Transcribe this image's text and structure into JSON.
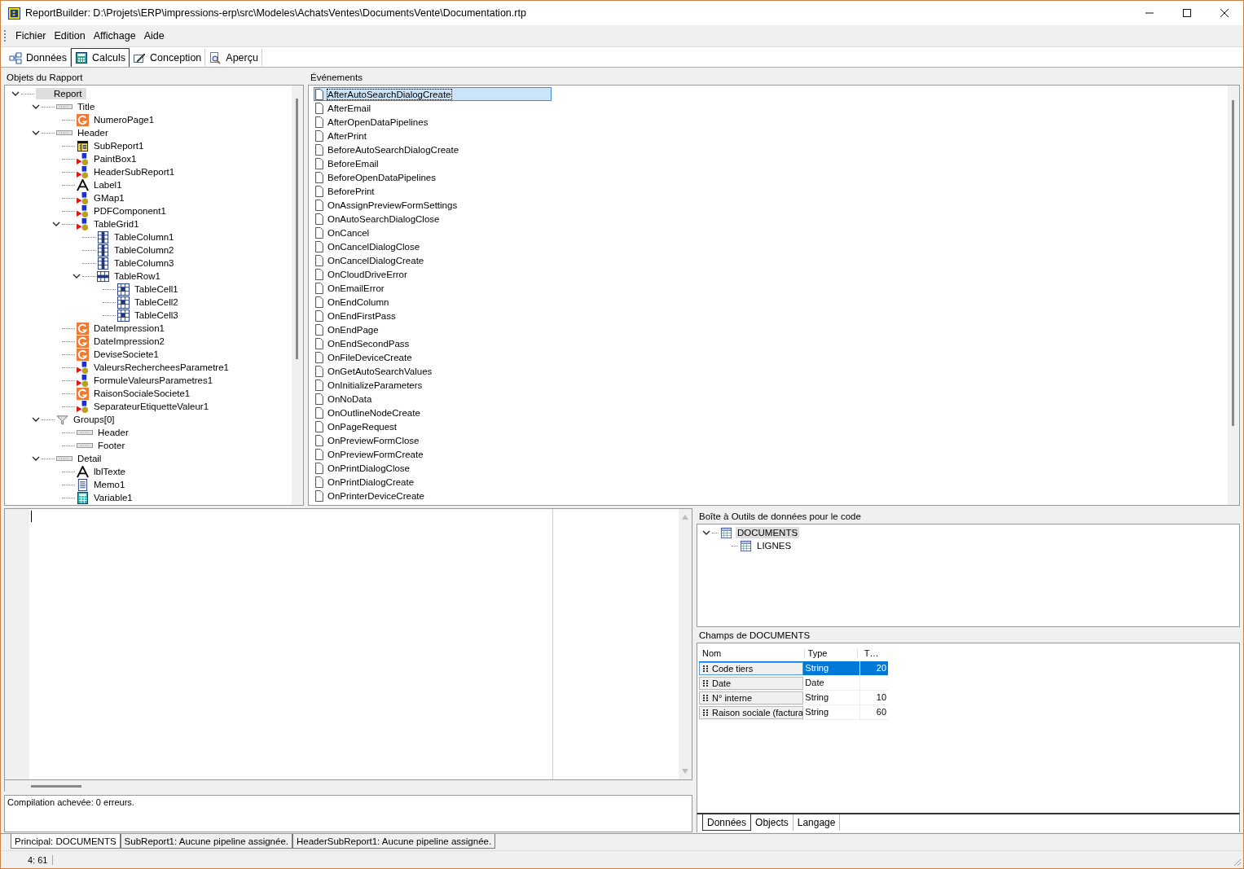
{
  "window": {
    "title": "ReportBuilder: D:\\Projets\\ERP\\impressions-erp\\src\\Modeles\\AchatsVentes\\DocumentsVente\\Documentation.rtp"
  },
  "menu": [
    {
      "label": "Fichier"
    },
    {
      "label": "Edition"
    },
    {
      "label": "Affichage"
    },
    {
      "label": "Aide"
    }
  ],
  "tabs": [
    {
      "label": "Données",
      "kind": "data",
      "selected": false
    },
    {
      "label": "Calculs",
      "kind": "calc",
      "selected": true
    },
    {
      "label": "Conception",
      "kind": "design",
      "selected": false
    },
    {
      "label": "Aperçu",
      "kind": "preview",
      "selected": false
    }
  ],
  "objects_panel": {
    "title": "Objets du Rapport",
    "tree": [
      {
        "label": "Report",
        "kind": "none",
        "selected": true,
        "expanded": true,
        "children": [
          {
            "label": "Title",
            "kind": "band",
            "selected": false,
            "expanded": true,
            "children": [
              {
                "label": "NumeroPage1",
                "kind": "calc",
                "selected": false
              }
            ]
          },
          {
            "label": "Header",
            "kind": "band",
            "selected": false,
            "expanded": true,
            "children": [
              {
                "label": "SubReport1",
                "kind": "subreport",
                "selected": false
              },
              {
                "label": "PaintBox1",
                "kind": "custom",
                "selected": false
              },
              {
                "label": "HeaderSubReport1",
                "kind": "custom",
                "selected": false
              },
              {
                "label": "Label1",
                "kind": "label",
                "selected": false
              },
              {
                "label": "GMap1",
                "kind": "custom",
                "selected": false
              },
              {
                "label": "PDFComponent1",
                "kind": "custom",
                "selected": false
              },
              {
                "label": "TableGrid1",
                "kind": "custom",
                "selected": false,
                "expanded": true,
                "children": [
                  {
                    "label": "TableColumn1",
                    "kind": "column",
                    "selected": false
                  },
                  {
                    "label": "TableColumn2",
                    "kind": "column",
                    "selected": false
                  },
                  {
                    "label": "TableColumn3",
                    "kind": "column",
                    "selected": false
                  },
                  {
                    "label": "TableRow1",
                    "kind": "row",
                    "selected": false,
                    "expanded": true,
                    "children": [
                      {
                        "label": "TableCell1",
                        "kind": "cell",
                        "selected": false
                      },
                      {
                        "label": "TableCell2",
                        "kind": "cell",
                        "selected": false
                      },
                      {
                        "label": "TableCell3",
                        "kind": "cell",
                        "selected": false
                      }
                    ]
                  }
                ]
              },
              {
                "label": "DateImpression1",
                "kind": "calc",
                "selected": false
              },
              {
                "label": "DateImpression2",
                "kind": "calc",
                "selected": false
              },
              {
                "label": "DeviseSociete1",
                "kind": "calc",
                "selected": false
              },
              {
                "label": "ValeursRechercheesParametre1",
                "kind": "custom",
                "selected": false
              },
              {
                "label": "FormuleValeursParametres1",
                "kind": "custom",
                "selected": false
              },
              {
                "label": "RaisonSocialeSociete1",
                "kind": "calc",
                "selected": false
              },
              {
                "label": "SeparateurEtiquetteValeur1",
                "kind": "custom",
                "selected": false
              }
            ]
          },
          {
            "label": "Groups[0]",
            "kind": "group",
            "selected": false,
            "expanded": true,
            "children": [
              {
                "label": "Header",
                "kind": "band",
                "selected": false
              },
              {
                "label": "Footer",
                "kind": "band",
                "selected": false
              }
            ]
          },
          {
            "label": "Detail",
            "kind": "band",
            "selected": false,
            "expanded": true,
            "children": [
              {
                "label": "lblTexte",
                "kind": "label",
                "selected": false
              },
              {
                "label": "Memo1",
                "kind": "memo",
                "selected": false
              },
              {
                "label": "Variable1",
                "kind": "variable",
                "selected": false
              }
            ]
          }
        ]
      }
    ]
  },
  "events_panel": {
    "title": "Événements",
    "events": [
      {
        "label": "AfterAutoSearchDialogCreate",
        "selected": true
      },
      {
        "label": "AfterEmail",
        "selected": false
      },
      {
        "label": "AfterOpenDataPipelines",
        "selected": false
      },
      {
        "label": "AfterPrint",
        "selected": false
      },
      {
        "label": "BeforeAutoSearchDialogCreate",
        "selected": false
      },
      {
        "label": "BeforeEmail",
        "selected": false
      },
      {
        "label": "BeforeOpenDataPipelines",
        "selected": false
      },
      {
        "label": "BeforePrint",
        "selected": false
      },
      {
        "label": "OnAssignPreviewFormSettings",
        "selected": false
      },
      {
        "label": "OnAutoSearchDialogClose",
        "selected": false
      },
      {
        "label": "OnCancel",
        "selected": false
      },
      {
        "label": "OnCancelDialogClose",
        "selected": false
      },
      {
        "label": "OnCancelDialogCreate",
        "selected": false
      },
      {
        "label": "OnCloudDriveError",
        "selected": false
      },
      {
        "label": "OnEmailError",
        "selected": false
      },
      {
        "label": "OnEndColumn",
        "selected": false
      },
      {
        "label": "OnEndFirstPass",
        "selected": false
      },
      {
        "label": "OnEndPage",
        "selected": false
      },
      {
        "label": "OnEndSecondPass",
        "selected": false
      },
      {
        "label": "OnFileDeviceCreate",
        "selected": false
      },
      {
        "label": "OnGetAutoSearchValues",
        "selected": false
      },
      {
        "label": "OnInitializeParameters",
        "selected": false
      },
      {
        "label": "OnNoData",
        "selected": false
      },
      {
        "label": "OnOutlineNodeCreate",
        "selected": false
      },
      {
        "label": "OnPageRequest",
        "selected": false
      },
      {
        "label": "OnPreviewFormClose",
        "selected": false
      },
      {
        "label": "OnPreviewFormCreate",
        "selected": false
      },
      {
        "label": "OnPrintDialogClose",
        "selected": false
      },
      {
        "label": "OnPrintDialogCreate",
        "selected": false
      },
      {
        "label": "OnPrinterDeviceCreate",
        "selected": false
      }
    ]
  },
  "toolbox": {
    "title": "Boîte à Outils de données pour le code",
    "tree": [
      {
        "label": "DOCUMENTS",
        "selected": true,
        "expanded": true,
        "children": [
          {
            "label": "LIGNES",
            "selected": false
          }
        ]
      }
    ]
  },
  "fields": {
    "title": "Champs de DOCUMENTS",
    "columns": [
      "Nom",
      "Type",
      "T…"
    ],
    "rows": [
      {
        "name": "Code tiers",
        "type": "String",
        "size": "20",
        "selected": true
      },
      {
        "name": "Date",
        "type": "Date",
        "size": "",
        "selected": false
      },
      {
        "name": "N° interne",
        "type": "String",
        "size": "10",
        "selected": false
      },
      {
        "name": "Raison sociale (factura",
        "type": "String",
        "size": "60",
        "selected": false
      }
    ]
  },
  "toolbox_tabs": [
    {
      "label": "Données",
      "selected": true
    },
    {
      "label": "Objects",
      "selected": false
    },
    {
      "label": "Langage",
      "selected": false
    }
  ],
  "messages": "Compilation achevée: 0 erreurs.",
  "pipeline_tabs": [
    {
      "label": "Principal: DOCUMENTS",
      "selected": true
    },
    {
      "label": "SubReport1: Aucune pipeline assignée.",
      "selected": false
    },
    {
      "label": "HeaderSubReport1: Aucune pipeline assignée.",
      "selected": false
    }
  ],
  "status_bar": {
    "position": "4: 61"
  }
}
